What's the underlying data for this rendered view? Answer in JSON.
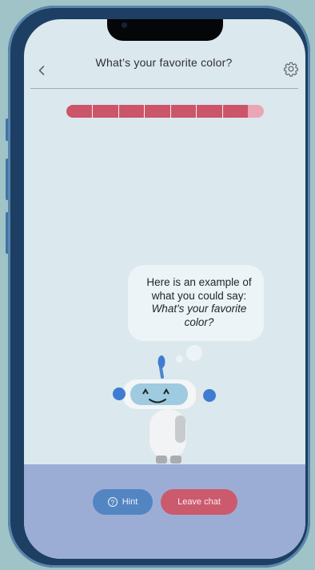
{
  "header": {
    "back_icon": "chevron-left-icon",
    "title": "What’s your favorite color?",
    "settings_icon": "gear-icon"
  },
  "progress": {
    "value": 0.92,
    "segments": 7
  },
  "bubble": {
    "text_plain": "Here is an example of what you could say: ",
    "text_example": "What's your favorite color?"
  },
  "actions": {
    "hint_label": "Hint",
    "hint_icon": "question-circle-icon",
    "leave_label": "Leave chat"
  },
  "colors": {
    "progress_fill": "#cc5569",
    "hint_button": "#5385c2",
    "leave_button": "#cc5a6d",
    "bottom_panel": "#9cadd5"
  }
}
